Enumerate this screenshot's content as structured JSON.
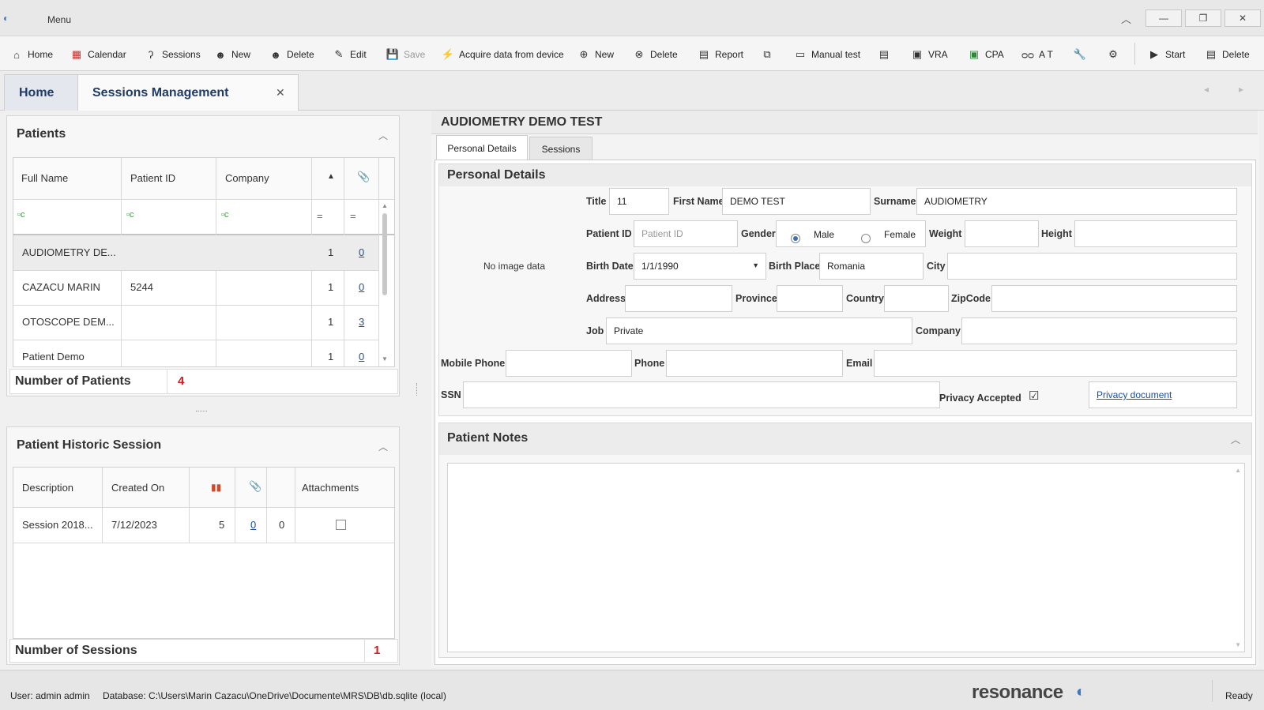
{
  "titlebar": {
    "menu": "Menu"
  },
  "toolbar": {
    "home": "Home",
    "calendar": "Calendar",
    "sessions": "Sessions",
    "new1": "New",
    "delete1": "Delete",
    "edit": "Edit",
    "save": "Save",
    "acquire": "Acquire data from device",
    "new2": "New",
    "delete2": "Delete",
    "report": "Report",
    "manual_test": "Manual test",
    "vra": "VRA",
    "cpa": "CPA",
    "at": "A T",
    "start": "Start",
    "delete3": "Delete"
  },
  "tabs": {
    "home": "Home",
    "sessions_mgmt": "Sessions Management"
  },
  "patients": {
    "title": "Patients",
    "columns": [
      "Full Name",
      "Patient ID",
      "Company"
    ],
    "rows": [
      {
        "name": "AUDIOMETRY DE...",
        "id": "",
        "company": "",
        "count": "1",
        "att": "0"
      },
      {
        "name": "CAZACU MARIN",
        "id": "5244",
        "company": "",
        "count": "1",
        "att": "0"
      },
      {
        "name": "OTOSCOPE DEM...",
        "id": "",
        "company": "",
        "count": "1",
        "att": "3"
      },
      {
        "name": "Patient Demo",
        "id": "",
        "company": "",
        "count": "1",
        "att": "0"
      }
    ],
    "count_label": "Number of Patients",
    "count_value": "4"
  },
  "history": {
    "title": "Patient Historic Session",
    "columns": [
      "Description",
      "Created On",
      "Attachments"
    ],
    "rows": [
      {
        "description": "Session 2018...",
        "created": "7/12/2023",
        "count": "5",
        "att": "0",
        "other": "0"
      }
    ],
    "count_label": "Number of Sessions",
    "count_value": "1"
  },
  "detail": {
    "header": "AUDIOMETRY DEMO TEST",
    "tabs": [
      "Personal Details",
      "Sessions"
    ],
    "section": "Personal Details",
    "no_image": "No image data",
    "labels": {
      "title": "Title",
      "first_name": "First Name",
      "surname": "Surname",
      "patient_id": "Patient ID",
      "gender": "Gender",
      "male": "Male",
      "female": "Female",
      "weight": "Weight",
      "height": "Height",
      "birth_date": "Birth Date",
      "birth_place": "Birth Place",
      "city": "City",
      "address": "Address",
      "province": "Province",
      "country": "Country",
      "zipcode": "ZipCode",
      "job": "Job",
      "company": "Company",
      "mobile_phone": "Mobile Phone",
      "phone": "Phone",
      "email": "Email",
      "ssn": "SSN",
      "privacy_accepted": "Privacy Accepted",
      "privacy_document": "Privacy document"
    },
    "values": {
      "title": "11",
      "first_name": "DEMO TEST",
      "surname": "AUDIOMETRY",
      "patient_id_placeholder": "Patient ID",
      "birth_date": "1/1/1990",
      "birth_place": "Romania",
      "job": "Private"
    },
    "notes_title": "Patient Notes"
  },
  "status": {
    "user": "User: admin admin",
    "database": "Database: C:\\Users\\Marin Cazacu\\OneDrive\\Documente\\MRS\\DB\\db.sqlite (local)",
    "logo": "resonance",
    "ready": "Ready"
  }
}
